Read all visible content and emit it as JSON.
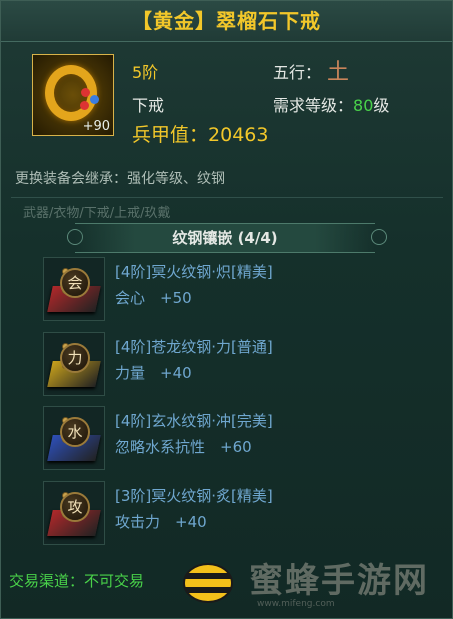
{
  "title": "【黄金】翠榴石下戒",
  "item": {
    "plus_level": "+90",
    "tier": "5阶",
    "wuxing_label": "五行：",
    "wuxing_value": "土",
    "slot": "下戒",
    "req_label": "需求等级：",
    "req_value": "80",
    "req_unit": "级",
    "power_label": "兵甲值：",
    "power_value": "20463"
  },
  "inherit_text": "更换装备会继承：强化等级、纹钢",
  "faded_text": "武器/衣物/下戒/上戒/玖戴",
  "section_title": "纹钢镶嵌 (4/4)",
  "gems": [
    {
      "badge": "会",
      "name": "[4阶]冥火纹钢·炽[精美]",
      "stat": "会心　+50",
      "base_color": "#b0282a",
      "name_color": "#6fa7cf",
      "icon": "gem-crit-icon"
    },
    {
      "badge": "力",
      "name": "[4阶]苍龙纹钢·力[普通]",
      "stat": "力量　+40",
      "base_color": "#c9a21c",
      "name_color": "#6fa7cf",
      "icon": "gem-strength-icon"
    },
    {
      "badge": "水",
      "name": "[4阶]玄水纹钢·冲[完美]",
      "stat": "忽略水系抗性　+60",
      "base_color": "#2d4fb8",
      "name_color": "#6fa7cf",
      "icon": "gem-water-icon"
    },
    {
      "badge": "攻",
      "name": "[3阶]冥火纹钢·炙[精美]",
      "stat": "攻击力　+40",
      "base_color": "#b0282a",
      "name_color": "#6fa7cf",
      "icon": "gem-attack-icon"
    }
  ],
  "trade_text": "交易渠道：不可交易",
  "watermark": {
    "text": "蜜蜂手游网",
    "url": "www.mifeng.com"
  }
}
